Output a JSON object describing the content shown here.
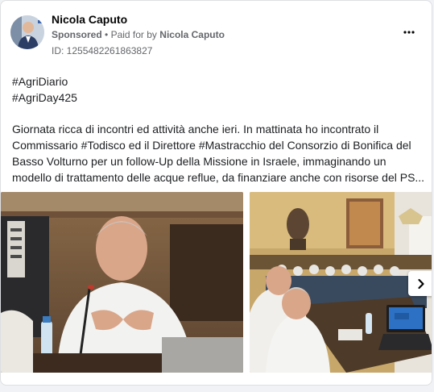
{
  "post": {
    "author": "Nicola Caputo",
    "sponsored_label": "Sponsored",
    "separator": "•",
    "paid_for_prefix": "Paid for by",
    "paid_for_name": "Nicola Caputo",
    "library_id": "ID: 1255482261863827",
    "more_icon": "more-horizontal-icon",
    "text_lines": [
      "#AgriDiario",
      "#AgriDay425",
      "",
      "Giornata ricca di incontri ed attività anche ieri. In mattinata ho incontrato il",
      "Commissario #Todisco ed il Direttore #Mastracchio del Consorzio di Bonifica del",
      "Basso Volturno per un follow-Up della Missione in Israele, immaginando un",
      "modello di trattamento delle acque reflue, da finanziare anche con risorse del PS..."
    ]
  },
  "carousel": {
    "next_icon": "chevron-right-icon"
  },
  "colors": {
    "primary_text": "#050505",
    "secondary_text": "#65676b",
    "card_border": "#dddfe2"
  }
}
